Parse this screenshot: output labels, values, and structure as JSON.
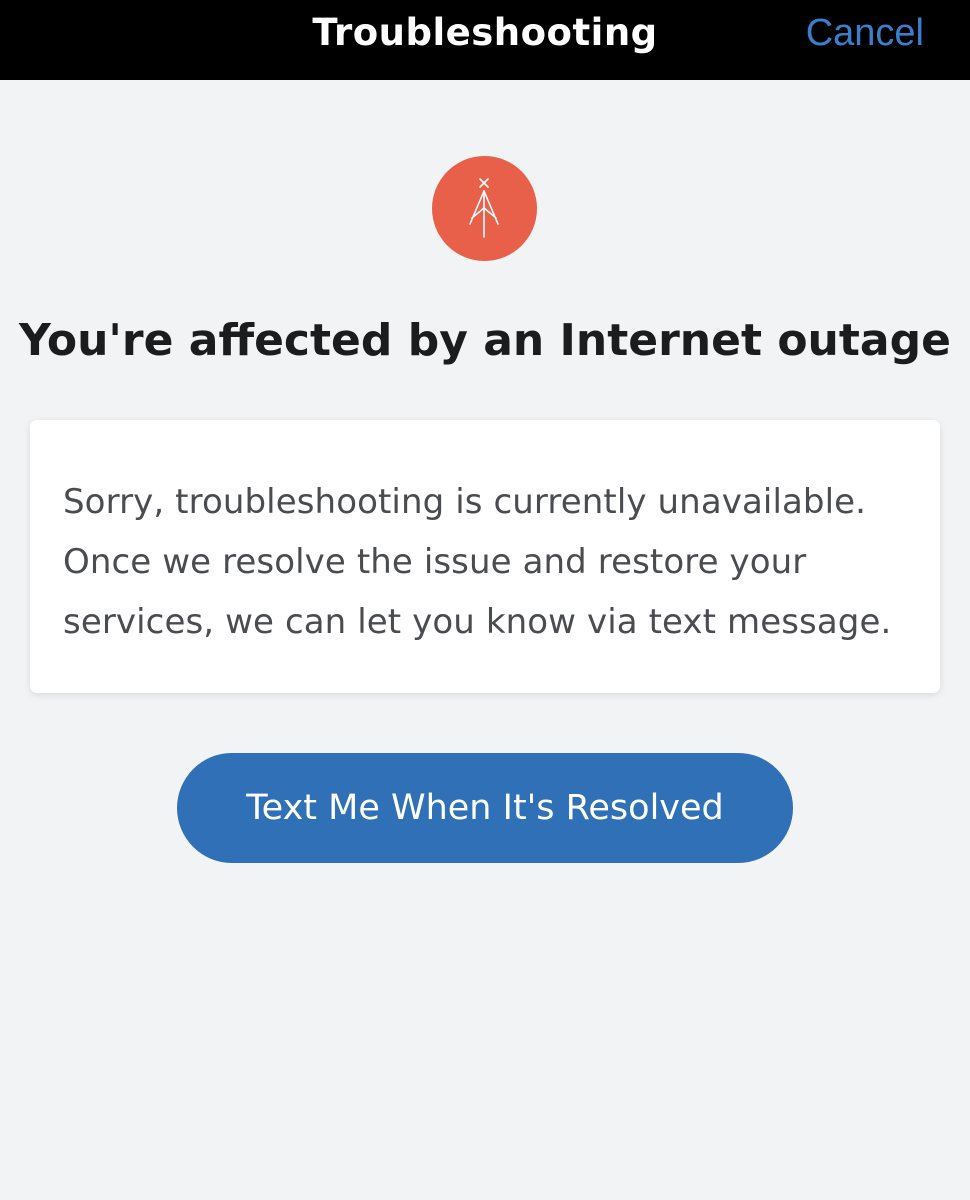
{
  "nav": {
    "title": "Troubleshooting",
    "cancel_label": "Cancel"
  },
  "status": {
    "icon": "broadcast-tower-icon",
    "badge_color": "#e8604a"
  },
  "content": {
    "headline": "You're affected by an Internet outage",
    "message_lines": [
      "Sorry, troubleshooting is currently unavailable.",
      "Once we resolve the issue and restore your",
      "services, we can let you know via text message."
    ]
  },
  "actions": {
    "notify_label": "Text Me When It's Resolved",
    "button_color": "#2f70b6"
  },
  "colors": {
    "nav_background": "#000000",
    "link_blue": "#3a7fcb",
    "page_background": "#f2f3f5"
  }
}
